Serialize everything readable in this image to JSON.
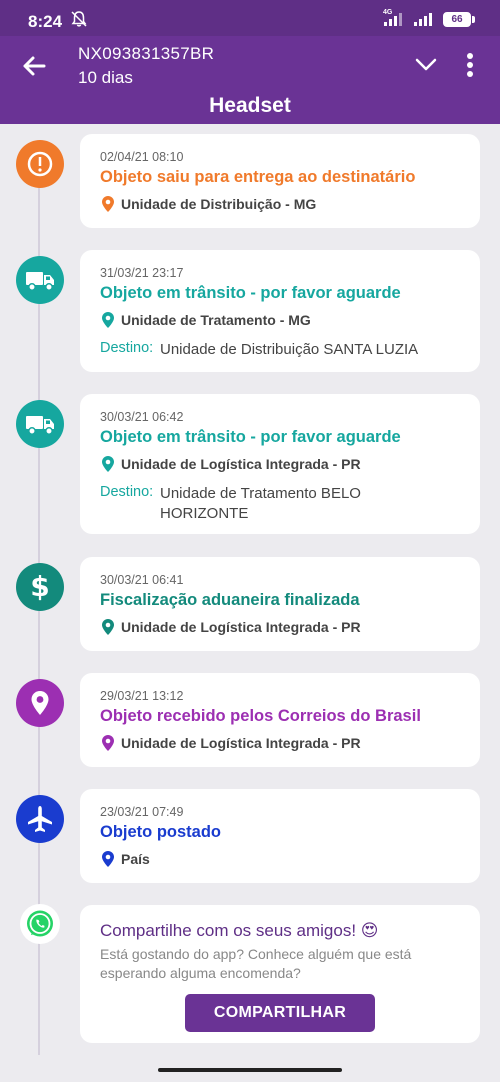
{
  "status_bar": {
    "time": "8:24",
    "network": "4G",
    "battery": "66"
  },
  "header": {
    "tracking_code": "NX093831357BR",
    "days": "10 dias",
    "title": "Headset"
  },
  "colors": {
    "orange": "#f07a2b",
    "teal": "#16a79f",
    "dark_teal": "#138a7c",
    "purple": "#9c2fb2",
    "blue": "#1a3ccf",
    "brand_purple": "#6a3395"
  },
  "events": [
    {
      "date": "02/04/21 08:10",
      "title": "Objeto saiu para entrega ao destinatário",
      "location": "Unidade de Distribuição - MG",
      "icon": "alert-icon"
    },
    {
      "date": "31/03/21 23:17",
      "title": "Objeto em trânsito - por favor aguarde",
      "location": "Unidade de Tratamento - MG",
      "dest_label": "Destino:",
      "dest_value": "Unidade de Distribuição SANTA LUZIA",
      "icon": "truck-icon"
    },
    {
      "date": "30/03/21 06:42",
      "title": "Objeto em trânsito - por favor aguarde",
      "location": "Unidade de Logística Integrada - PR",
      "dest_label": "Destino:",
      "dest_value": "Unidade de Tratamento BELO HORIZONTE",
      "icon": "truck-icon"
    },
    {
      "date": "30/03/21 06:41",
      "title": "Fiscalização aduaneira finalizada",
      "location": "Unidade de Logística Integrada - PR",
      "icon": "dollar-icon"
    },
    {
      "date": "29/03/21 13:12",
      "title": "Objeto recebido pelos Correios do Brasil",
      "location": "Unidade de Logística Integrada - PR",
      "icon": "map-pin-icon"
    },
    {
      "date": "23/03/21 07:49",
      "title": "Objeto postado",
      "location": "País",
      "icon": "airplane-icon"
    }
  ],
  "share": {
    "title": "Compartilhe com os seus amigos! 😍",
    "subtitle": "Está gostando do app? Conhece alguém que está esperando alguma encomenda?",
    "button": "COMPARTILHAR",
    "icon": "whatsapp-icon"
  }
}
